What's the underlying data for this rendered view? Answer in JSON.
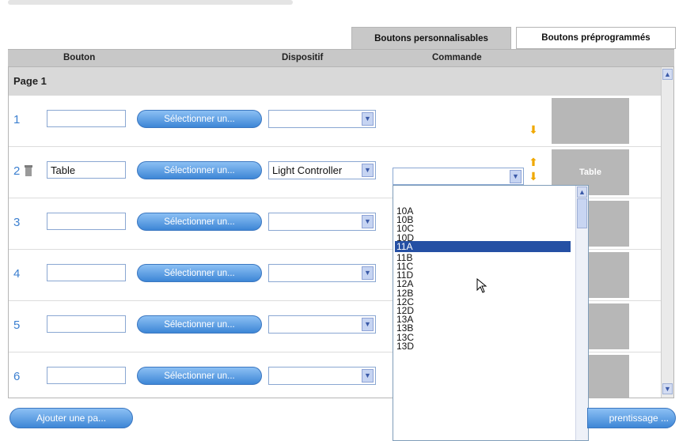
{
  "tabs": {
    "custom": "Boutons personnalisables",
    "preset": "Boutons préprogrammés"
  },
  "columns": {
    "button": "Bouton",
    "device": "Dispositif",
    "command": "Commande"
  },
  "page_label": "Page 1",
  "select_label": "Sélectionner un...",
  "rows": [
    {
      "number": "1",
      "name": "",
      "device": "",
      "preview": ""
    },
    {
      "number": "2",
      "name": "Table",
      "device": "Light Controller",
      "preview": "Table"
    },
    {
      "number": "3",
      "name": "",
      "device": "",
      "preview": ""
    },
    {
      "number": "4",
      "name": "",
      "device": "",
      "preview": ""
    },
    {
      "number": "5",
      "name": "",
      "device": "",
      "preview": ""
    },
    {
      "number": "6",
      "name": "",
      "device": "",
      "preview": ""
    }
  ],
  "command_options": [
    "10A",
    "10B",
    "10C",
    "10D",
    "11A",
    "11B",
    "11C",
    "11D",
    "12A",
    "12B",
    "12C",
    "12D",
    "13A",
    "13B",
    "13C",
    "13D"
  ],
  "command_selected": "11A",
  "bottom": {
    "add_page": "Ajouter une pa...",
    "learn": "prentissage ..."
  },
  "icons": {
    "move_up": "arrow-up-icon",
    "move_down": "arrow-down-icon",
    "delete": "trash-icon",
    "dropdown": "chevron-down-icon"
  },
  "colors": {
    "accent_button": "#3d86d6",
    "selection": "#2550a4",
    "arrow": "#f0a800",
    "row_number": "#3b7fd0"
  }
}
